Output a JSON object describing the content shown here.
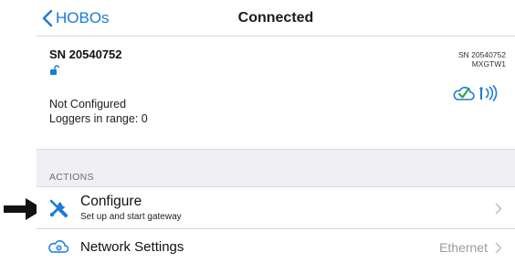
{
  "nav": {
    "back_label": "HOBOs",
    "title": "Connected"
  },
  "device": {
    "serial": "SN 20540752",
    "status": "Not Configured",
    "loggers_in_range": "Loggers in range: 0",
    "serial_small": "SN 20540752",
    "gateway_id": "MXGTW1",
    "icons": [
      "unlock-icon",
      "cloud-check-icon",
      "wireless-signal-icon"
    ]
  },
  "actions": {
    "header": "ACTIONS",
    "configure": {
      "title": "Configure",
      "subtitle": "Set up and start gateway",
      "icon": "wrench-screwdriver-icon"
    },
    "network": {
      "title": "Network Settings",
      "value": "Ethernet",
      "icon": "network-gear-icon"
    }
  },
  "colors": {
    "accent": "#1a7bd9",
    "section_bg": "#efeff4",
    "cloud_check": "#2aa84a"
  }
}
